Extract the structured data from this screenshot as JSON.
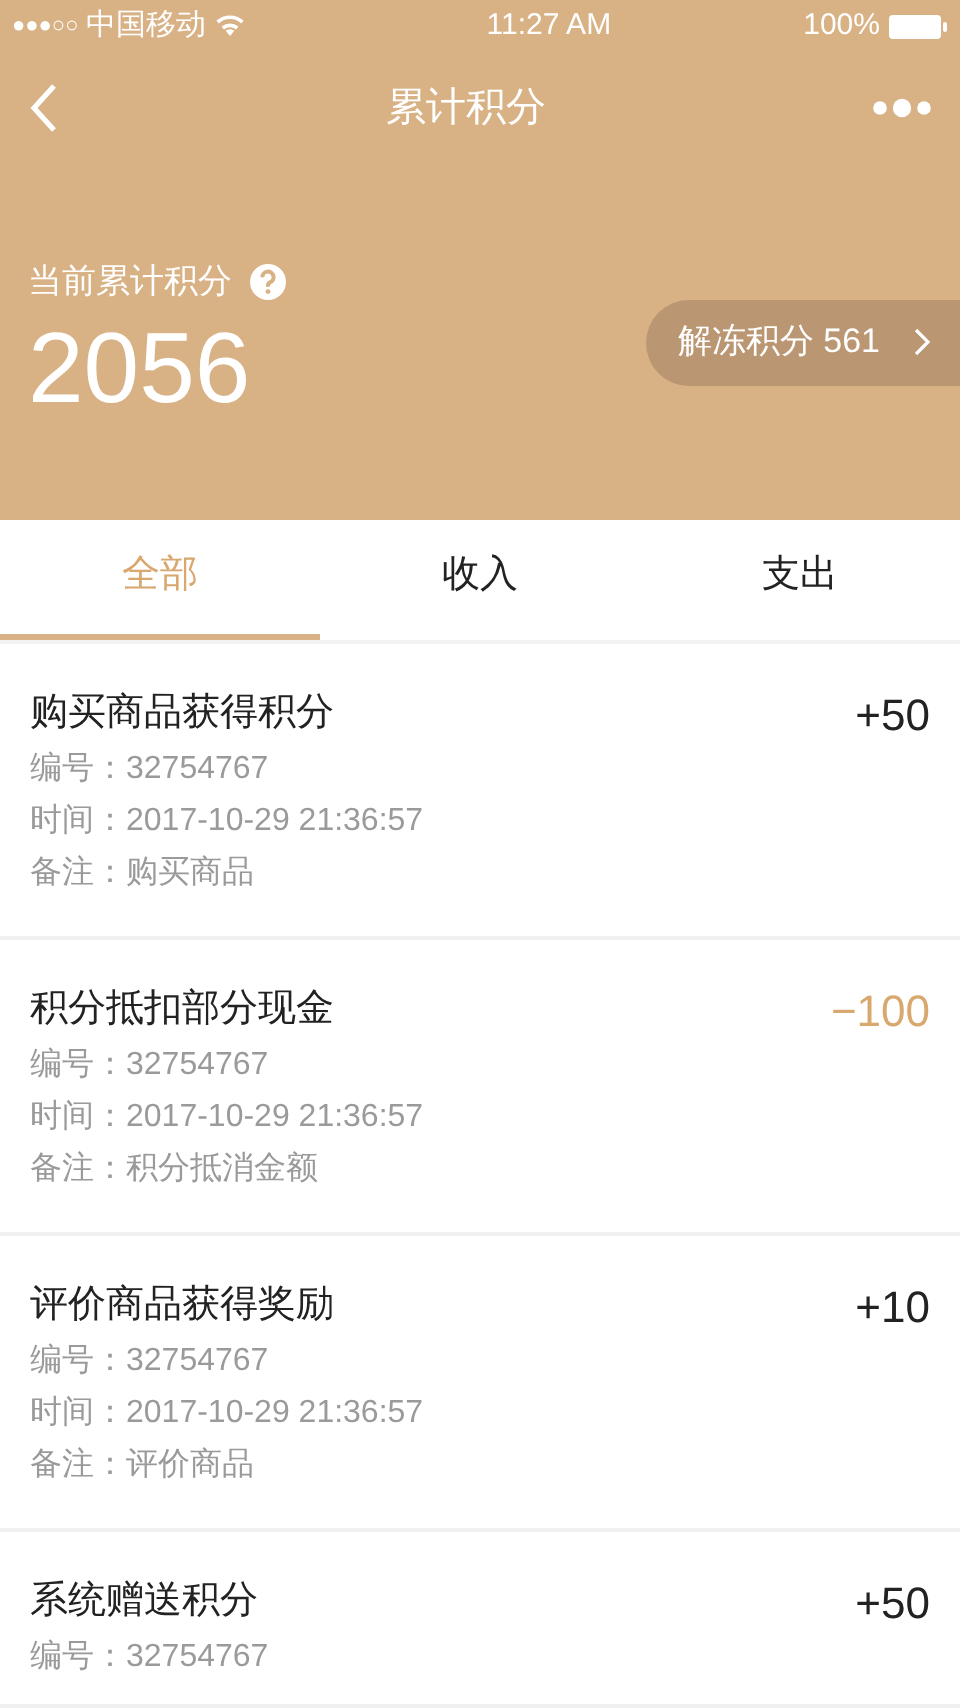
{
  "status_bar": {
    "signal": "●●●○○",
    "carrier": "中国移动",
    "time": "11:27 AM",
    "battery": "100%"
  },
  "nav": {
    "title": "累计积分"
  },
  "summary": {
    "label": "当前累计积分",
    "total": "2056",
    "unfreeze": "解冻积分 561"
  },
  "tabs": [
    {
      "label": "全部",
      "selected": true
    },
    {
      "label": "收入",
      "selected": false
    },
    {
      "label": "支出",
      "selected": false
    }
  ],
  "records": [
    {
      "title": "购买商品获得积分",
      "amount": "+50",
      "kind": "income",
      "lines": [
        "编号：32754767",
        "时间：2017-10-29 21:36:57",
        "备注：购买商品"
      ]
    },
    {
      "title": "积分抵扣部分现金",
      "amount": "−100",
      "kind": "expense",
      "lines": [
        "编号：32754767",
        "时间：2017-10-29 21:36:57",
        "备注：积分抵消金额"
      ]
    },
    {
      "title": "评价商品获得奖励",
      "amount": "+10",
      "kind": "income",
      "lines": [
        "编号：32754767",
        "时间：2017-10-29 21:36:57",
        "备注：评价商品"
      ]
    },
    {
      "title": "系统赠送积分",
      "amount": "+50",
      "kind": "income",
      "lines": [
        "编号：32754767"
      ]
    }
  ]
}
